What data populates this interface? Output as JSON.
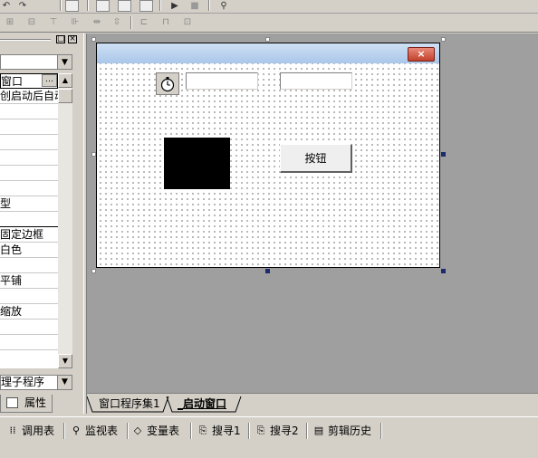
{
  "toolbar": {
    "row1_icons": [
      "undo-icon",
      "redo-icon",
      "preview-icon",
      "layout-1-icon",
      "layout-2-icon",
      "layout-3-icon",
      "run-icon",
      "stop-icon",
      "binoculars-icon"
    ],
    "row2_icons": [
      "align-left-icon",
      "align-center-icon",
      "align-top-icon",
      "align-middle-icon",
      "space-horizontal-icon",
      "space-vertical-icon",
      "same-width-icon",
      "same-height-icon",
      "same-size-icon"
    ]
  },
  "panel": {
    "header_pin": "□",
    "header_close": "×",
    "combo_value": "",
    "more_button": "…",
    "rows": [
      "窗口",
      "创启动后自动",
      "",
      "",
      "",
      "",
      "",
      "",
      "型",
      "",
      "固定边框",
      "白色",
      "",
      "平铺",
      "",
      "缩放",
      "",
      ""
    ],
    "combo2_value": "理子程序",
    "properties_tab": "属性"
  },
  "form": {
    "close_label": "×",
    "edit1_value": "",
    "edit2_value": "",
    "button_label": "按钮"
  },
  "tabs": [
    {
      "label": "窗口程序集1",
      "active": false
    },
    {
      "label": "_启动窗口",
      "active": true
    }
  ],
  "bottom": [
    {
      "icon": "grid-icon",
      "label": "调用表"
    },
    {
      "icon": "magnifier-icon",
      "label": "监视表"
    },
    {
      "icon": "variables-icon",
      "label": "变量表"
    },
    {
      "icon": "search-doc-icon",
      "label": "搜寻1"
    },
    {
      "icon": "search-doc-icon",
      "label": "搜寻2"
    },
    {
      "icon": "clipboard-icon",
      "label": "剪辑历史"
    }
  ]
}
